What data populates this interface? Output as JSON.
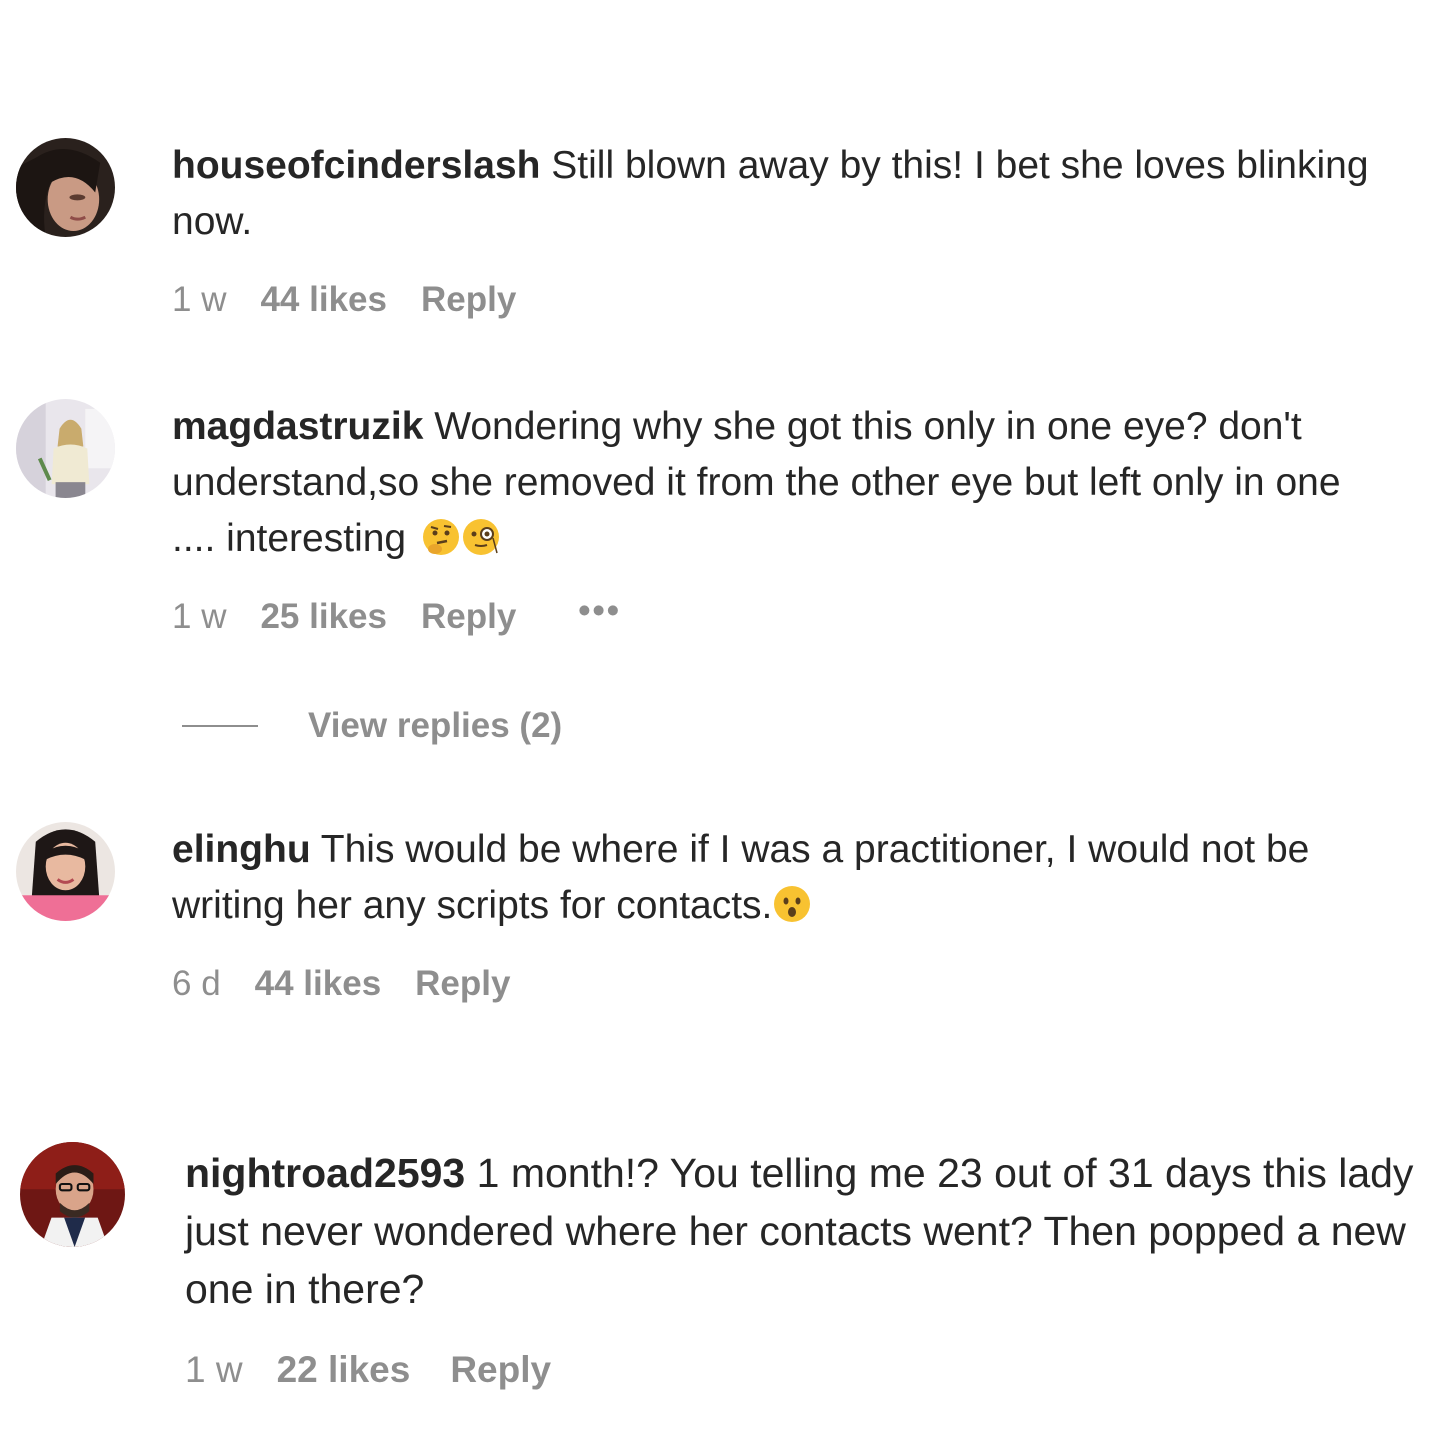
{
  "comments": [
    {
      "username": "houseofcinderslash",
      "text": "Still blown away by this! I bet she loves blinking now.",
      "time": "1 w",
      "likes": "44 likes",
      "reply": "Reply"
    },
    {
      "username": "magdastruzik",
      "text": "Wondering why she got this only in one eye? don't understand,so she removed it from the other eye but left only in one .... interesting",
      "emojis": [
        "thinking-face-emoji",
        "face-with-monocle-emoji"
      ],
      "time": "1 w",
      "likes": "25 likes",
      "reply": "Reply",
      "more": "•••",
      "view_replies": "View replies (2)"
    },
    {
      "username": "elinghu",
      "text": "This would be where if I was a practitioner, I would not be writing her any scripts for contacts.",
      "emojis": [
        "hushed-face-emoji"
      ],
      "time": "6 d",
      "likes": "44 likes",
      "reply": "Reply"
    },
    {
      "username": "nightroad2593",
      "text": "1 month!? You telling me 23 out of 31 days this lady just never wondered where her contacts went? Then popped a new one in there?",
      "time": "1 w",
      "likes": "22 likes",
      "reply": "Reply"
    }
  ],
  "colors": {
    "text": "#262626",
    "meta": "#8e8e8e",
    "background": "#ffffff"
  }
}
